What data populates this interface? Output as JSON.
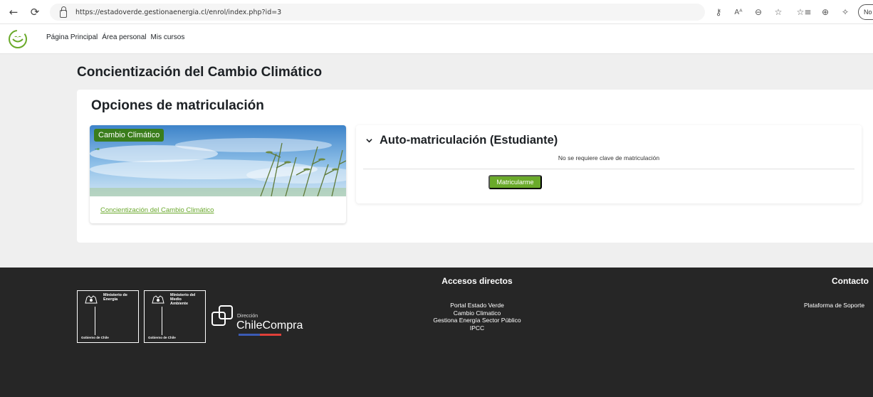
{
  "browser": {
    "url": "https://estadoverde.gestionaenergia.cl/enrol/index.php?id=3",
    "profile_label": "No",
    "icons": [
      "back-arrow-icon",
      "reload-icon",
      "lock-icon",
      "key-icon",
      "read-aloud-icon",
      "zoom-icon",
      "favorite-star-icon",
      "favorites-list-icon",
      "collections-icon",
      "extensions-icon"
    ]
  },
  "site_nav": {
    "logo": "estado-verde-logo",
    "items": [
      {
        "label": "Página Principal"
      },
      {
        "label": "Área personal"
      },
      {
        "label": "Mis cursos"
      }
    ]
  },
  "course": {
    "title": "Concientización del Cambio Climático"
  },
  "enrolment": {
    "heading": "Opciones de matriculación",
    "card": {
      "category_badge": "Cambio Climático",
      "link": "Concientización del Cambio Climático"
    },
    "method": {
      "heading": "Auto-matriculación (Estudiante)",
      "note": "No se requiere clave de matriculación",
      "button_label": "Matricularme"
    }
  },
  "footer": {
    "logos": {
      "ministry_energy": [
        "Ministerio de",
        "Energía"
      ],
      "ministry_environment": [
        "Ministerio del",
        "Medio",
        "Ambiente"
      ],
      "government": "Gobierno de Chile",
      "chilecompra_small": "Dirección",
      "chilecompra_main": "ChileCompra"
    },
    "links_title": "Accesos directos",
    "links": [
      {
        "label": "Portal Estado Verde"
      },
      {
        "label": "Cambio Climatico"
      },
      {
        "label": "Gestiona Energía Sector Público"
      },
      {
        "label": "IPCC"
      }
    ],
    "contact_title": "Contacto",
    "contact_link": "Plataforma de Soporte"
  },
  "colors": {
    "accent_green": "#6aaa2a",
    "badge_green": "#3a7d1c",
    "footer_bg": "#262626",
    "page_bg": "#efefef"
  }
}
